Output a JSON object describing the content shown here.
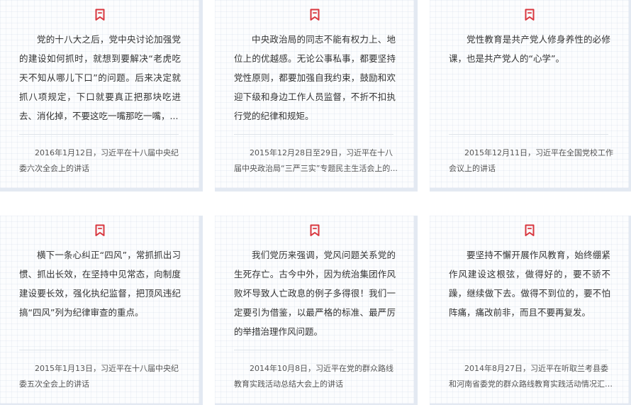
{
  "icon": {
    "name": "bookmark-icon",
    "color": "#d9363e"
  },
  "cards": [
    {
      "quote": "党的十八大之后，党中央讨论加强党的建设如何抓时，就想到要解决“老虎吃天不知从哪儿下口”的问题。后来决定就抓八项规定，下口就要真正把那块吃进去、消化掉，不要这吃一嘴那吃一嘴，...",
      "source": "2016年1月12日，习近平在十八届中央纪委六次全会上的讲话"
    },
    {
      "quote": "中央政治局的同志不能有权力上、地位上的优越感。无论公事私事，都要坚持党性原则，都要加强自我约束，鼓励和欢迎下级和身边工作人员监督，不折不扣执行党的纪律和规矩。",
      "source": "2015年12月28日至29日，习近平在十八届中央政治局“三严三实”专题民主生活会上的..."
    },
    {
      "quote": "党性教育是共产党人修身养性的必修课，也是共产党人的“心学”。",
      "source": "2015年12月11日，习近平在全国党校工作会议上的讲话"
    },
    {
      "quote": "横下一条心纠正“四风”，常抓抓出习惯、抓出长效，在坚持中见常态，向制度建设要长效，强化执纪监督，把顶风违纪搞“四风”列为纪律审查的重点。",
      "source": "2015年1月13日，习近平在十八届中央纪委五次全会上的讲话"
    },
    {
      "quote": "我们党历来强调，党风问题关系党的生死存亡。古今中外，因为统治集团作风败坏导致人亡政息的例子多得很！我们一定要引为借鉴，以最严格的标准、最严厉的举措治理作风问题。",
      "source": "2014年10月8日，习近平在党的群众路线教育实践活动总结大会上的讲话"
    },
    {
      "quote": "要坚持不懈开展作风教育，始终绷紧作风建设这根弦，做得好的，要不骄不躁，继续做下去。做得不到位的，要不怕阵痛，痛改前非，而且不要再复发。",
      "source": "2014年8月27日，习近平在听取兰考县委和河南省委党的群众路线教育实践活动情况汇报..."
    }
  ]
}
